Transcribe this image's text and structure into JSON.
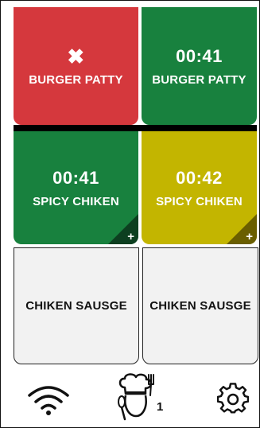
{
  "tiles": [
    {
      "top": "✖",
      "label": "BURGER PATTY",
      "state": "alert",
      "color": "#d5383d"
    },
    {
      "top": "00:41",
      "label": "BURGER PATTY",
      "state": "cooking",
      "color": "#18813e"
    },
    {
      "top": "00:41",
      "label": "SPICY CHIKEN",
      "state": "cooking",
      "color": "#18813e",
      "plus": "+"
    },
    {
      "top": "00:42",
      "label": "SPICY CHIKEN",
      "state": "warning",
      "color": "#c3b500",
      "plus": "+"
    },
    {
      "label": "CHIKEN SAUSGE",
      "state": "idle"
    },
    {
      "label": "CHIKEN SAUSGE",
      "state": "idle"
    }
  ],
  "bottom_bar": {
    "icons": [
      "wifi-icon",
      "chef-icon",
      "gear-icon"
    ],
    "chef_count": "1"
  }
}
